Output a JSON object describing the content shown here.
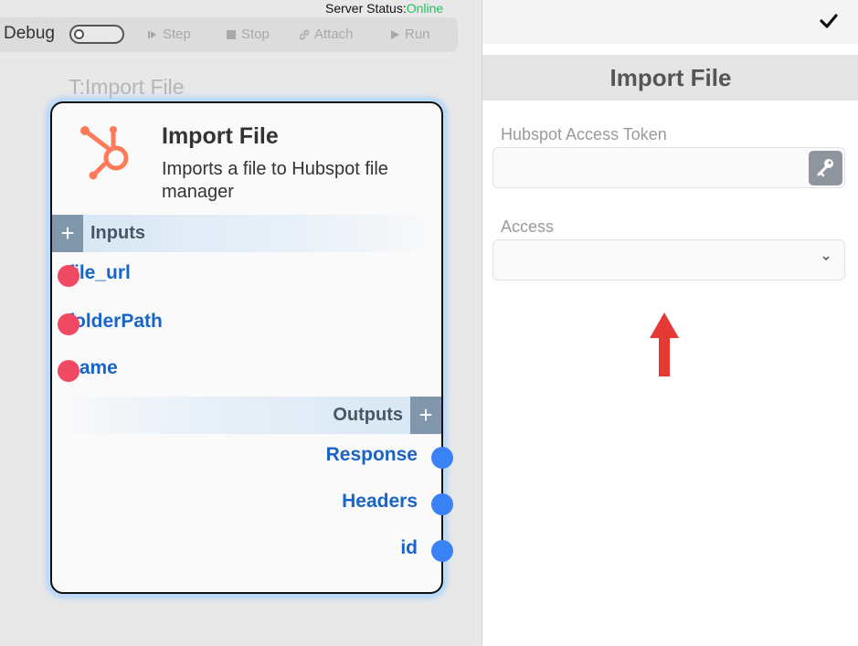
{
  "server_status": {
    "label": "Server Status:",
    "value": "Online",
    "value_color": "#22c55e"
  },
  "toolbar": {
    "debug_label": "Debug",
    "debug_enabled": false,
    "step_label": "Step",
    "stop_label": "Stop",
    "attach_label": "Attach",
    "run_label": "Run"
  },
  "canvas": {
    "node_tag": "T:Import File"
  },
  "node": {
    "name": "Import File",
    "description": "Imports a file to Hubspot file manager",
    "logo": "hubspot-icon",
    "accent_color": "#ff7a59",
    "inputs_label": "Inputs",
    "outputs_label": "Outputs",
    "inputs": [
      "file_url",
      "folderPath",
      "name"
    ],
    "outputs": [
      "Response",
      "Headers",
      "id"
    ]
  },
  "panel": {
    "title": "Import File",
    "fields": {
      "token_label": "Hubspot Access Token",
      "token_value": "",
      "access_label": "Access",
      "access_value": ""
    },
    "icons": {
      "confirm": "check-icon",
      "token_button": "key-icon",
      "access_dropdown": "chevron-down-icon",
      "annotation": "up-arrow-icon"
    },
    "annotation_color": "#e53935"
  }
}
